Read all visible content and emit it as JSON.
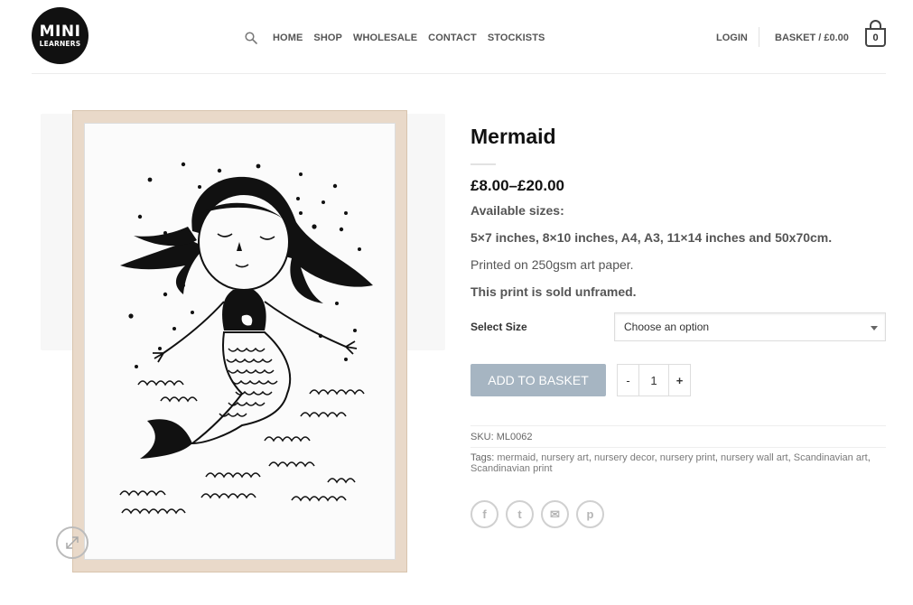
{
  "logo": {
    "line1": "MINI",
    "line2": "LEARNERS"
  },
  "nav": {
    "items": [
      "HOME",
      "SHOP",
      "WHOLESALE",
      "CONTACT",
      "STOCKISTS"
    ]
  },
  "header": {
    "login": "LOGIN",
    "basket_label": "BASKET / £0.00",
    "basket_count": "0"
  },
  "product": {
    "title": "Mermaid",
    "price": "£8.00–£20.00",
    "sizes_heading": "Available sizes:",
    "sizes": "5×7 inches, 8×10 inches, A4, A3, 11×14 inches and 50x70cm.",
    "paper": "Printed on 250gsm art paper.",
    "unframed": "This print is sold unframed.",
    "select_label": "Select Size",
    "select_value": "Choose an option",
    "add_to_basket": "ADD TO BASKET",
    "qty_minus": "-",
    "qty_value": "1",
    "qty_plus": "+",
    "sku": "SKU: ML0062",
    "tags_prefix": "Tags: ",
    "tags": [
      "mermaid",
      "nursery art",
      "nursery decor",
      "nursery print",
      "nursery wall art",
      "Scandinavian art",
      "Scandinavian print"
    ]
  },
  "share": {
    "icons": [
      "facebook-icon",
      "twitter-icon",
      "email-icon",
      "pinterest-icon"
    ],
    "glyphs": [
      "f",
      "t",
      "✉",
      "p"
    ]
  },
  "colors": {
    "button_bg": "#a6b5c2",
    "frame": "#e9d9c9",
    "text_dark": "#111111"
  }
}
